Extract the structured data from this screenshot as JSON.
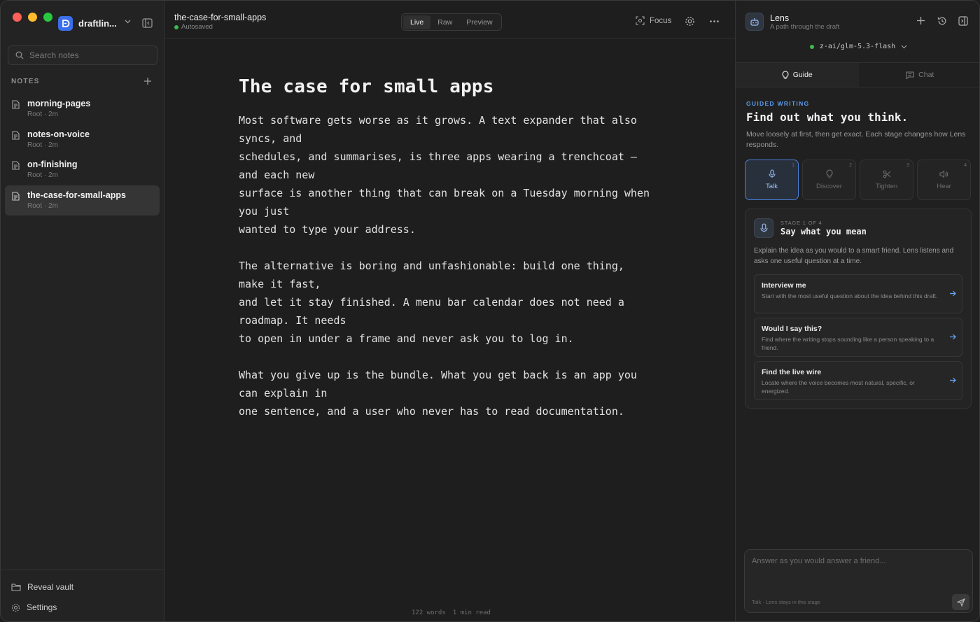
{
  "sidebar": {
    "vault_name": "draftlin...",
    "search_placeholder": "Search notes",
    "notes_header": "NOTES",
    "notes": [
      {
        "title": "morning-pages",
        "meta": "Root · 2m"
      },
      {
        "title": "notes-on-voice",
        "meta": "Root · 2m"
      },
      {
        "title": "on-finishing",
        "meta": "Root · 2m"
      },
      {
        "title": "the-case-for-small-apps",
        "meta": "Root · 2m"
      }
    ],
    "reveal_vault": "Reveal vault",
    "settings": "Settings"
  },
  "editor": {
    "doc_title": "the-case-for-small-apps",
    "status": "Autosaved",
    "modes": [
      "Live",
      "Raw",
      "Preview"
    ],
    "focus_label": "Focus",
    "heading": "The case for small apps",
    "paragraphs": [
      "Most software gets worse as it grows. A text expander that also\nsyncs, and\nschedules, and summarises, is three apps wearing a trenchcoat —\nand each new\nsurface is another thing that can break on a Tuesday morning when\nyou just\nwanted to type your address.",
      "The alternative is boring and unfashionable: build one thing,\nmake it fast,\nand let it stay finished. A menu bar calendar does not need a\nroadmap. It needs\nto open in under a frame and never ask you to log in.",
      "What you give up is the bundle. What you get back is an app you\ncan explain in\none sentence, and a user who never has to read documentation."
    ],
    "word_count": "122 words",
    "read_time": "1 min read"
  },
  "lens": {
    "title": "Lens",
    "subtitle": "A path through the draft",
    "model": "z-ai/glm-5.3-flash",
    "tabs": [
      "Guide",
      "Chat"
    ],
    "kicker": "GUIDED WRITING",
    "heading": "Find out what you think.",
    "description": "Move loosely at first, then get exact. Each stage changes how Lens responds.",
    "stages": [
      {
        "num": "1",
        "label": "Talk"
      },
      {
        "num": "2",
        "label": "Discover"
      },
      {
        "num": "3",
        "label": "Tighten"
      },
      {
        "num": "4",
        "label": "Hear"
      }
    ],
    "card": {
      "kicker": "STAGE 1 OF 4",
      "title": "Say what you mean",
      "description": "Explain the idea as you would to a smart friend. Lens listens and asks one useful question at a time.",
      "options": [
        {
          "title": "Interview me",
          "desc": "Start with the most useful question about the idea behind this draft."
        },
        {
          "title": "Would I say this?",
          "desc": "Find where the writing stops sounding like a person speaking to a friend."
        },
        {
          "title": "Find the live wire",
          "desc": "Locate where the voice becomes most natural, specific, or energized."
        }
      ]
    },
    "answer_placeholder": "Answer as you would answer a friend...",
    "answer_hint": "Talk · Lens stays in this stage"
  },
  "colors": {
    "accent": "#3b6ee8",
    "kicker_blue": "#5b9cf0",
    "status_green": "#3fb950"
  }
}
